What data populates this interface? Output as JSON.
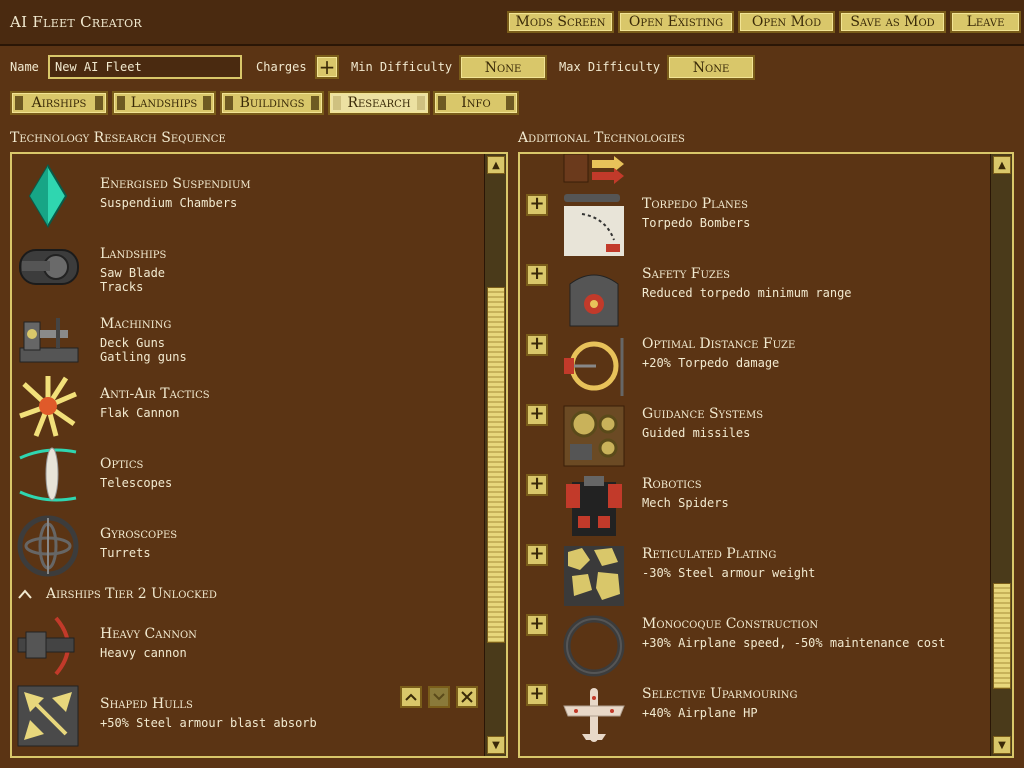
{
  "app": {
    "title": "AI Fleet Creator"
  },
  "topbar": {
    "buttons": [
      "Mods Screen",
      "Open Existing",
      "Open Mod",
      "Save as Mod",
      "Leave"
    ]
  },
  "form": {
    "name_label": "Name",
    "name_value": "New AI Fleet",
    "charges_label": "Charges",
    "min_difficulty_label": "Min Difficulty",
    "min_difficulty_value": "None",
    "max_difficulty_label": "Max Difficulty",
    "max_difficulty_value": "None"
  },
  "tabs": [
    "Airships",
    "Landships",
    "Buildings",
    "Research",
    "Info"
  ],
  "active_tab": "Research",
  "left_panel": {
    "title": "Technology Research Sequence",
    "tier_unlock_label": "Airships Tier 2 Unlocked",
    "items": [
      {
        "title": "Energised Suspendium",
        "lines": [
          "Suspendium Chambers"
        ],
        "icon": "crystal-icon"
      },
      {
        "title": "Landships",
        "lines": [
          "Saw Blade",
          "Tracks"
        ],
        "icon": "tank-tread-icon"
      },
      {
        "title": "Machining",
        "lines": [
          "Deck Guns",
          "Gatling guns"
        ],
        "icon": "lathe-icon"
      },
      {
        "title": "Anti-Air Tactics",
        "lines": [
          "Flak Cannon"
        ],
        "icon": "flak-burst-icon"
      },
      {
        "title": "Optics",
        "lines": [
          "Telescopes"
        ],
        "icon": "lens-icon"
      },
      {
        "title": "Gyroscopes",
        "lines": [
          "Turrets"
        ],
        "icon": "gyroscope-icon"
      },
      {
        "title": "Heavy Cannon",
        "lines": [
          "Heavy cannon"
        ],
        "icon": "heavy-cannon-icon"
      },
      {
        "title": "Shaped Hulls",
        "lines": [
          "+50% Steel armour blast absorb"
        ],
        "icon": "hull-arrows-icon"
      }
    ]
  },
  "right_panel": {
    "title": "Additional Technologies",
    "items": [
      {
        "title": "Torpedo Planes",
        "lines": [
          "Torpedo Bombers"
        ],
        "icon": "torpedo-chart-icon"
      },
      {
        "title": "Safety Fuzes",
        "lines": [
          "Reduced torpedo minimum range"
        ],
        "icon": "fuze-mechanism-icon"
      },
      {
        "title": "Optimal Distance Fuze",
        "lines": [
          "+20% Torpedo damage"
        ],
        "icon": "fuze-ring-icon"
      },
      {
        "title": "Guidance Systems",
        "lines": [
          "Guided missiles"
        ],
        "icon": "gears-icon"
      },
      {
        "title": "Robotics",
        "lines": [
          "Mech Spiders"
        ],
        "icon": "robot-icon"
      },
      {
        "title": "Reticulated Plating",
        "lines": [
          "-30% Steel armour weight"
        ],
        "icon": "plating-icon"
      },
      {
        "title": "Monocoque Construction",
        "lines": [
          "+30% Airplane speed, -50% maintenance cost"
        ],
        "icon": "fuselage-ring-icon"
      },
      {
        "title": "Selective Uparmouring",
        "lines": [
          "+40% Airplane HP"
        ],
        "icon": "airplane-icon"
      }
    ]
  },
  "scroll": {
    "left_position": 0.55,
    "right_position": 0.9
  }
}
